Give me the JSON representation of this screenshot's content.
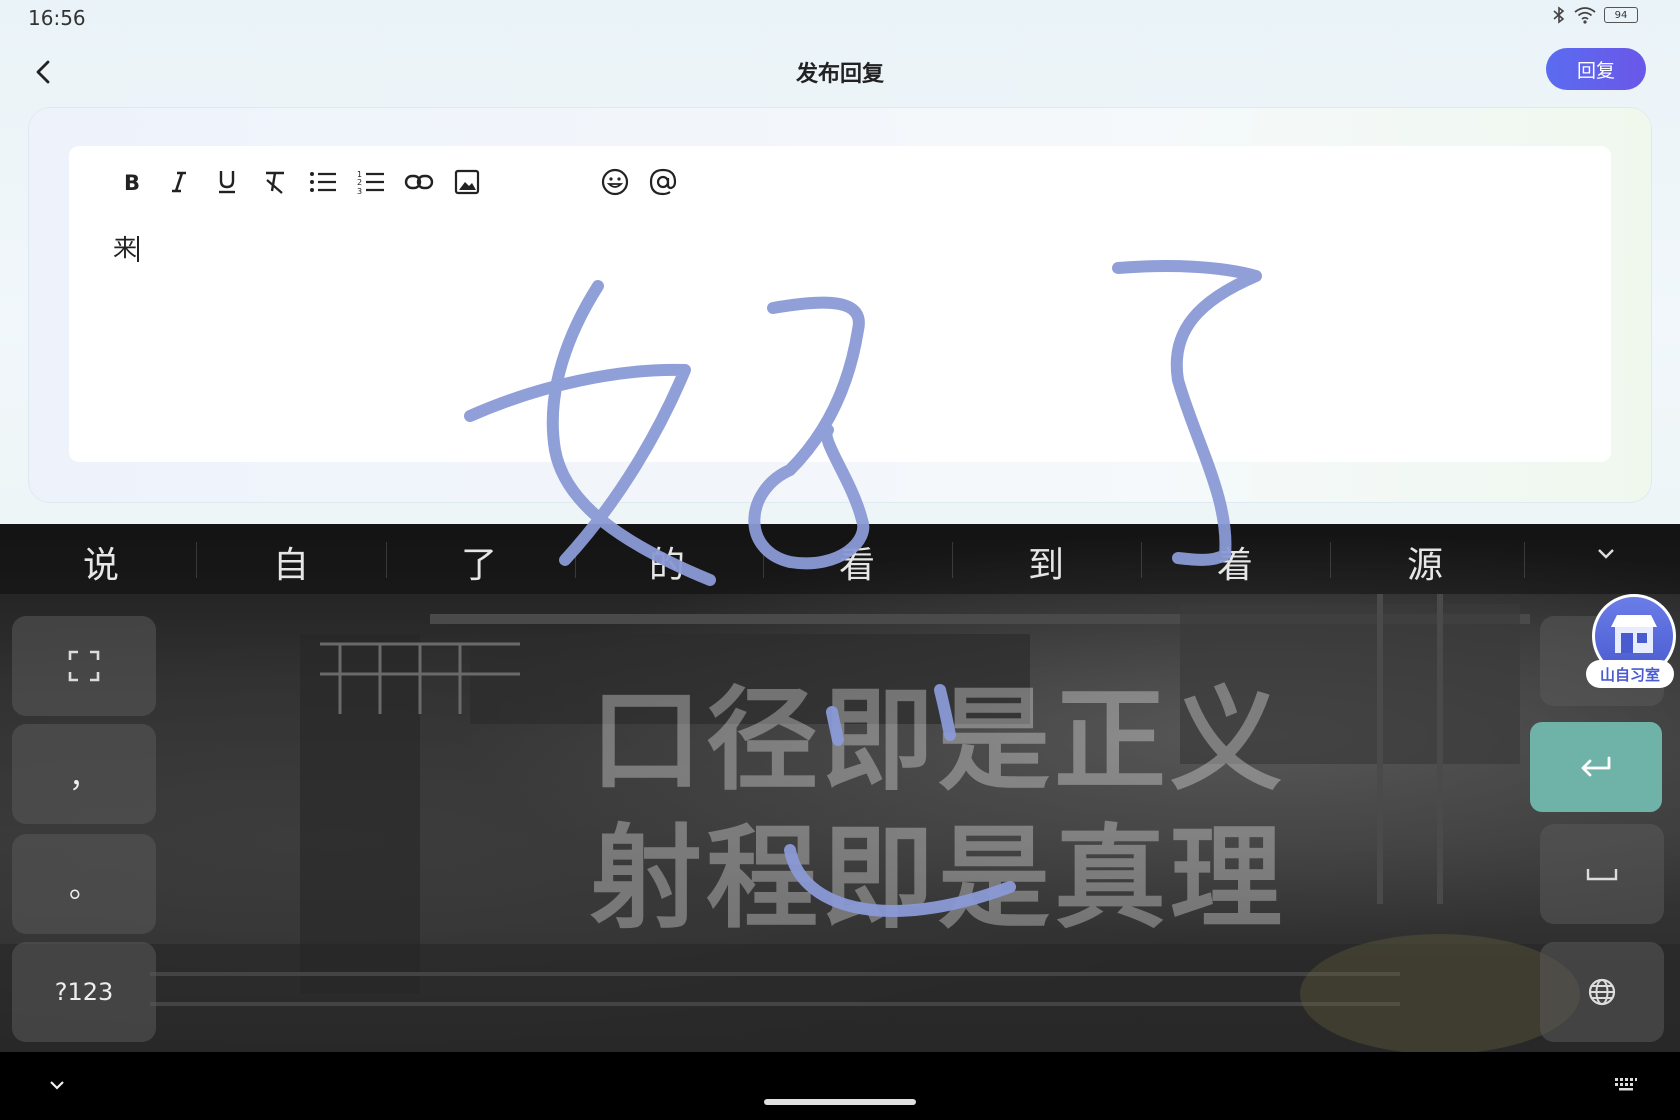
{
  "status": {
    "time": "16:56",
    "battery": "94"
  },
  "header": {
    "title": "发布回复",
    "reply_label": "回复"
  },
  "editor": {
    "toolbar": [
      "bold-icon",
      "italic-icon",
      "underline-icon",
      "clear-format-icon",
      "bullet-list-icon",
      "numbered-list-icon",
      "link-icon",
      "image-icon",
      "emoji-icon",
      "mention-icon"
    ],
    "content": "来"
  },
  "keyboard": {
    "candidates": [
      "说",
      "自",
      "了",
      "的",
      "看",
      "到",
      "着",
      "源"
    ],
    "watermark_line1": "口径即是正义",
    "watermark_line2": "射程即是真理",
    "comma": "，",
    "period": "。",
    "symbols_label": "?123",
    "badge_label": "山自习室",
    "handwriting_color": "#8a9ad6",
    "enter_color": "#6fb2a8"
  }
}
